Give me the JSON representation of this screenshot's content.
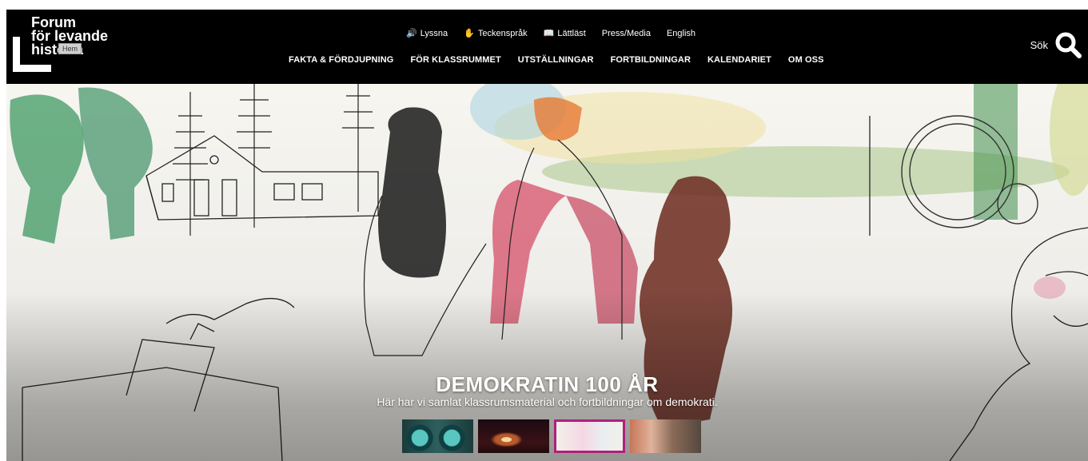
{
  "logo": {
    "lines": [
      "Forum",
      "för levande",
      "historia"
    ],
    "tooltip": "Hem"
  },
  "utility_nav": [
    {
      "label": "Lyssna",
      "icon": "speaker-icon",
      "glyph": "🔊"
    },
    {
      "label": "Teckenspråk",
      "icon": "sign-language-icon",
      "glyph": "✋"
    },
    {
      "label": "Lättläst",
      "icon": "easy-read-icon",
      "glyph": "📖"
    },
    {
      "label": "Press/Media"
    },
    {
      "label": "English"
    }
  ],
  "main_nav": [
    "FAKTA & FÖRDJUPNING",
    "FÖR KLASSRUMMET",
    "UTSTÄLLNINGAR",
    "FORTBILDNINGAR",
    "KALENDARIET",
    "OM OSS"
  ],
  "search": {
    "label": "Sök",
    "icon": "search-icon"
  },
  "hero": {
    "title": "DEMOKRATIN 100 ÅR",
    "subtitle": "Här har vi samlat klassrumsmaterial och fortbildningar om demokrati.",
    "active_slide": 3,
    "slide_count": 4
  },
  "colors": {
    "header_bg": "#000000",
    "active_thumb_border": "#b0207a"
  }
}
